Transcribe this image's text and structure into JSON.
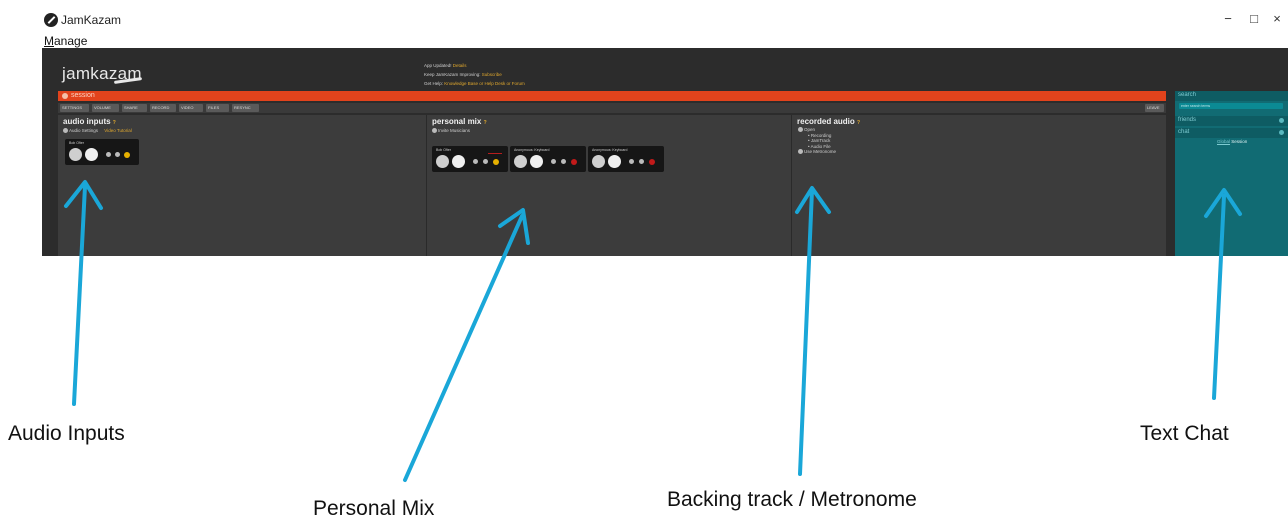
{
  "window": {
    "title": "JamKazam",
    "minimize": "−",
    "maximize": "□",
    "close": "×",
    "menu": {
      "first_letter": "M",
      "rest": "anage"
    }
  },
  "app": {
    "logo_text": "jamkazam",
    "notices": [
      {
        "text": "App Updated! ",
        "link": "Details",
        "suffix": ""
      },
      {
        "text": "Keep JamKazam Improving: ",
        "link": "Subscribe",
        "suffix": ""
      },
      {
        "text": "Get Help: ",
        "link": "Knowledge Base or Help Desk or Forum",
        "suffix": ""
      }
    ],
    "user": {
      "name": "M M",
      "caret": "▾"
    },
    "session": {
      "label": "session",
      "toolbar": [
        "SETTINGS",
        "VOLUME",
        "SHARE",
        "RECORD",
        "VIDEO",
        "FILES",
        "RESYNC"
      ],
      "leave_label": "LEAVE"
    },
    "audio_inputs": {
      "title": "audio inputs",
      "help": "?",
      "settings_link": "Audio Settings",
      "tutorial_link": "Video Tutorial",
      "track_name": "Bob Ofter"
    },
    "personal_mix": {
      "title": "personal mix",
      "help": "?",
      "invite": "Invite Musicians",
      "tracks": [
        {
          "name": "Bob Ofter",
          "dot_color": "#e6b000"
        },
        {
          "name": "Anonymous: Keyboard",
          "dot_color": "#c21a1a"
        },
        {
          "name": "Anonymous: Keyboard",
          "dot_color": "#c21a1a"
        }
      ]
    },
    "recorded_audio": {
      "title": "recorded audio",
      "help": "?",
      "open": "Open",
      "items": [
        "Recording",
        "JamTrack",
        "Audio File"
      ],
      "metronome": "Use Metronome"
    },
    "sidebar": {
      "search": "search",
      "search_placeholder": "enter search terms",
      "friends": "friends",
      "chat": "chat",
      "chat_prefix": "Global",
      "chat_suffix": "Session"
    }
  },
  "annotations": {
    "audio_inputs": "Audio Inputs",
    "personal_mix": "Personal Mix",
    "backing_track": "Backing track / Metronome",
    "text_chat": "Text Chat",
    "arrow_color": "#1aa7d8"
  }
}
